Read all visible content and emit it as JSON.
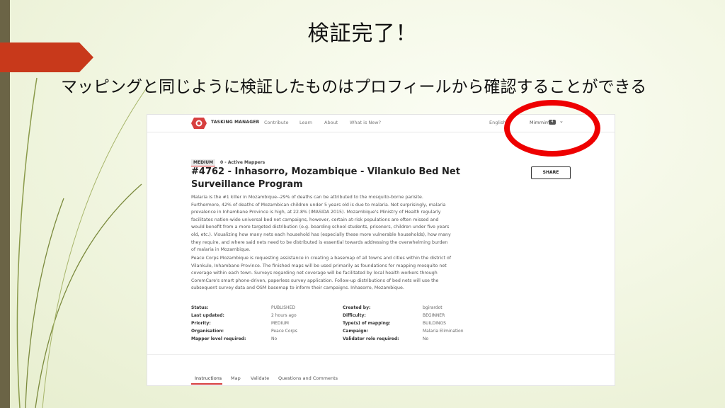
{
  "slide": {
    "title": "検証完了！",
    "subtitle": "マッピングと同じように検証したものはプロフィールから確認することができる"
  },
  "nav": {
    "logo_text": "TASKING MANAGER",
    "links": [
      "Contribute",
      "Learn",
      "About",
      "What is New?"
    ],
    "language": "English",
    "username": "Mimmimi",
    "notification_count": "4"
  },
  "project": {
    "difficulty": "MEDIUM",
    "mappers": "0 - Active Mappers",
    "title": "#4762 - Inhasorro, Mozambique - Vilankulo Bed Net Surveillance Program",
    "share_label": "SHARE",
    "description_1": "Malaria is the #1 killer in Mozambique--29% of deaths can be attributed to the mosquito-borne parisite. Furthermore, 42% of deaths of Mozambican children under 5 years old is due to malaria. Not surprisingly, malaria prevalence in Inhambane Province is high, at 22.8% (IMASIDA 2015). Mozambique's Ministry of Health regularly facilitates nation-wide universal bed net campaigns, however, certain at-risk populations are often missed and would benefit from a more targeted distribution (e.g. boarding school students, prisoners, children under five years old, etc.). Visualizing how many nets each household has (especially these more vulnerable households), how many they require, and where said nets need to be distributed is essential towards addressing the overwhelming burden of malaria in Mozambique.",
    "description_2": "Peace Corps Mozambique is requesting assistance in creating a basemap of all towns and cities within the district of Vilankulo, Inhambane Province. The finished maps will be used primarily as foundations for mapping mosquito net coverage within each town. Surveys regarding net coverage will be facilitated by local health workers through CommCare's smart phone-driven, paperless survey application. Follow-up distributions of bed nets will use the subsequent survey data and OSM basemap to inform their campaigns. Inhasorro, Mozambique."
  },
  "meta_left": [
    {
      "label": "Status:",
      "value": "PUBLISHED"
    },
    {
      "label": "Last updated:",
      "value": "2 hours ago"
    },
    {
      "label": "Priority:",
      "value": "MEDIUM"
    },
    {
      "label": "Organisation:",
      "value": "Peace Corps"
    },
    {
      "label": "Mapper level required:",
      "value": "No"
    }
  ],
  "meta_right": [
    {
      "label": "Created by:",
      "value": "bgirardot"
    },
    {
      "label": "Difficulty:",
      "value": "BEGINNER"
    },
    {
      "label": "Type(s) of mapping:",
      "value": "BUILDINGS"
    },
    {
      "label": "Campaign:",
      "value": "Malaria Elimination"
    },
    {
      "label": "Validator role required:",
      "value": "No"
    }
  ],
  "tabs": [
    "Instructions",
    "Map",
    "Validate",
    "Questions and Comments"
  ],
  "colors": {
    "accent_tab": "#c8391b",
    "highlight_ring": "#ee0000",
    "hot_red": "#d73f3f"
  }
}
